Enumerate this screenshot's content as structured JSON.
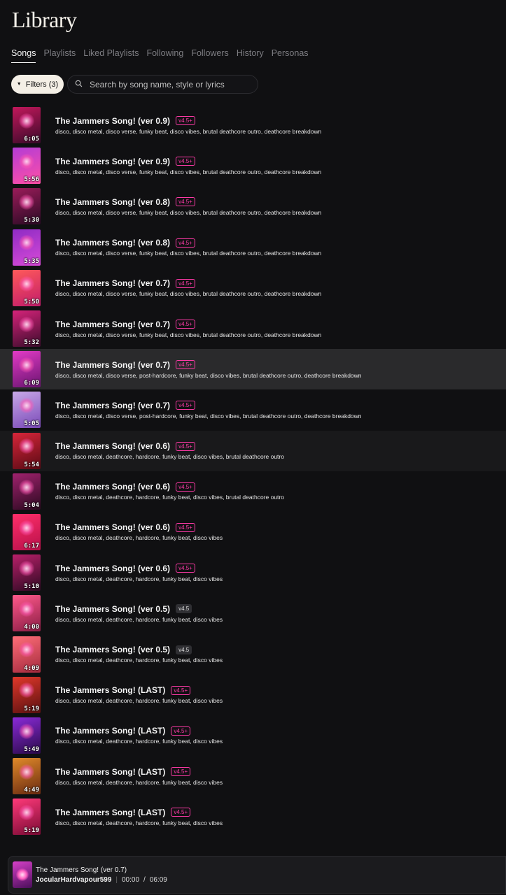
{
  "page": {
    "title": "Library"
  },
  "tabs": [
    {
      "label": "Songs",
      "active": true
    },
    {
      "label": "Playlists",
      "active": false
    },
    {
      "label": "Liked Playlists",
      "active": false
    },
    {
      "label": "Following",
      "active": false
    },
    {
      "label": "Followers",
      "active": false
    },
    {
      "label": "History",
      "active": false
    },
    {
      "label": "Personas",
      "active": false
    }
  ],
  "filters": {
    "label": "Filters (3)",
    "icon": "caret-down-icon"
  },
  "search": {
    "placeholder": "Search by song name, style or lyrics",
    "value": "",
    "icon": "search-icon"
  },
  "songs": [
    {
      "title": "The Jammers Song! (ver 0.9)",
      "badge": "v4.5+",
      "badge_style": "pink",
      "duration": "6:05",
      "tags": "disco, disco metal, disco verse, funky beat, disco vibes, brutal deathcore outro, deathcore breakdown",
      "colors": [
        "#c2185b",
        "#3a0a2a"
      ]
    },
    {
      "title": "The Jammers Song! (ver 0.9)",
      "badge": "v4.5+",
      "badge_style": "pink",
      "duration": "5:56",
      "tags": "disco, disco metal, disco verse, funky beat, disco vibes, brutal deathcore outro, deathcore breakdown",
      "colors": [
        "#b33cd6",
        "#ff4fa6"
      ]
    },
    {
      "title": "The Jammers Song! (ver 0.8)",
      "badge": "v4.5+",
      "badge_style": "pink",
      "duration": "5:30",
      "tags": "disco, disco metal, disco verse, funky beat, disco vibes, brutal deathcore outro, deathcore breakdown",
      "colors": [
        "#9b1c5a",
        "#2a0a24"
      ]
    },
    {
      "title": "The Jammers Song! (ver 0.8)",
      "badge": "v4.5+",
      "badge_style": "pink",
      "duration": "5:35",
      "tags": "disco, disco metal, disco verse, funky beat, disco vibes, brutal deathcore outro, deathcore breakdown",
      "colors": [
        "#8e2bc4",
        "#d84bd8"
      ]
    },
    {
      "title": "The Jammers Song! (ver 0.7)",
      "badge": "v4.5+",
      "badge_style": "pink",
      "duration": "5:50",
      "tags": "disco, disco metal, disco verse, funky beat, disco vibes, brutal deathcore outro, deathcore breakdown",
      "colors": [
        "#ff5a5a",
        "#c21c6a"
      ]
    },
    {
      "title": "The Jammers Song! (ver 0.7)",
      "badge": "v4.5+",
      "badge_style": "pink",
      "duration": "5:32",
      "tags": "disco, disco metal, disco verse, funky beat, disco vibes, brutal deathcore outro, deathcore breakdown",
      "colors": [
        "#d6237a",
        "#3c0c2c"
      ]
    },
    {
      "title": "The Jammers Song! (ver 0.7)",
      "badge": "v4.5+",
      "badge_style": "pink",
      "duration": "6:09",
      "tags": "disco, disco metal, disco verse, post-hardcore, funky beat, disco vibes, brutal deathcore outro, deathcore breakdown",
      "colors": [
        "#e23bc6",
        "#6a1470"
      ]
    },
    {
      "title": "The Jammers Song! (ver 0.7)",
      "badge": "v4.5+",
      "badge_style": "pink",
      "duration": "5:05",
      "tags": "disco, disco metal, disco verse, post-hardcore, funky beat, disco vibes, brutal deathcore outro, deathcore breakdown",
      "colors": [
        "#c8a8e8",
        "#7a4ab8"
      ]
    },
    {
      "title": "The Jammers Song! (ver 0.6)",
      "badge": "v4.5+",
      "badge_style": "pink",
      "duration": "5:54",
      "tags": "disco, disco metal, deathcore, hardcore, funky beat, disco vibes, brutal deathcore outro",
      "colors": [
        "#d8263a",
        "#5a0a14"
      ]
    },
    {
      "title": "The Jammers Song! (ver 0.6)",
      "badge": "v4.5+",
      "badge_style": "pink",
      "duration": "5:04",
      "tags": "disco, disco metal, deathcore, hardcore, funky beat, disco vibes, brutal deathcore outro",
      "colors": [
        "#a0226e",
        "#2c0a20"
      ]
    },
    {
      "title": "The Jammers Song! (ver 0.6)",
      "badge": "v4.5+",
      "badge_style": "pink",
      "duration": "6:17",
      "tags": "disco, disco metal, deathcore, hardcore, funky beat, disco vibes",
      "colors": [
        "#ff2f6a",
        "#b8104a"
      ]
    },
    {
      "title": "The Jammers Song! (ver 0.6)",
      "badge": "v4.5+",
      "badge_style": "pink",
      "duration": "5:10",
      "tags": "disco, disco metal, deathcore, hardcore, funky beat, disco vibes",
      "colors": [
        "#b8206a",
        "#2e0a22"
      ]
    },
    {
      "title": "The Jammers Song! (ver 0.5)",
      "badge": "v4.5",
      "badge_style": "gray",
      "duration": "4:00",
      "tags": "disco, disco metal, deathcore, hardcore, funky beat, disco vibes",
      "colors": [
        "#ff5a8c",
        "#8a1c44"
      ]
    },
    {
      "title": "The Jammers Song! (ver 0.5)",
      "badge": "v4.5",
      "badge_style": "gray",
      "duration": "4:09",
      "tags": "disco, disco metal, deathcore, hardcore, funky beat, disco vibes",
      "colors": [
        "#ff6e78",
        "#a42a3e"
      ]
    },
    {
      "title": "The Jammers Song! (LAST)",
      "badge": "v4.5+",
      "badge_style": "pink",
      "duration": "5:19",
      "tags": "disco, disco metal, deathcore, hardcore, funky beat, disco vibes",
      "colors": [
        "#e0382a",
        "#5a1010"
      ]
    },
    {
      "title": "The Jammers Song! (LAST)",
      "badge": "v4.5+",
      "badge_style": "pink",
      "duration": "5:49",
      "tags": "disco, disco metal, deathcore, hardcore, funky beat, disco vibes",
      "colors": [
        "#8a2ad8",
        "#2a0a4a"
      ]
    },
    {
      "title": "The Jammers Song! (LAST)",
      "badge": "v4.5+",
      "badge_style": "pink",
      "duration": "4:49",
      "tags": "disco, disco metal, deathcore, hardcore, funky beat, disco vibes",
      "colors": [
        "#e08a2a",
        "#6a2a10"
      ]
    },
    {
      "title": "The Jammers Song! (LAST)",
      "badge": "v4.5+",
      "badge_style": "pink",
      "duration": "5:19",
      "tags": "disco, disco metal, deathcore, hardcore, funky beat, disco vibes",
      "colors": [
        "#ff3a7a",
        "#7a0a34"
      ]
    }
  ],
  "player": {
    "title": "The Jammers Song! (ver 0.7)",
    "artist": "JocularHardvapour599",
    "current_time": "00:00",
    "separator": "/",
    "total_time": "06:09"
  }
}
